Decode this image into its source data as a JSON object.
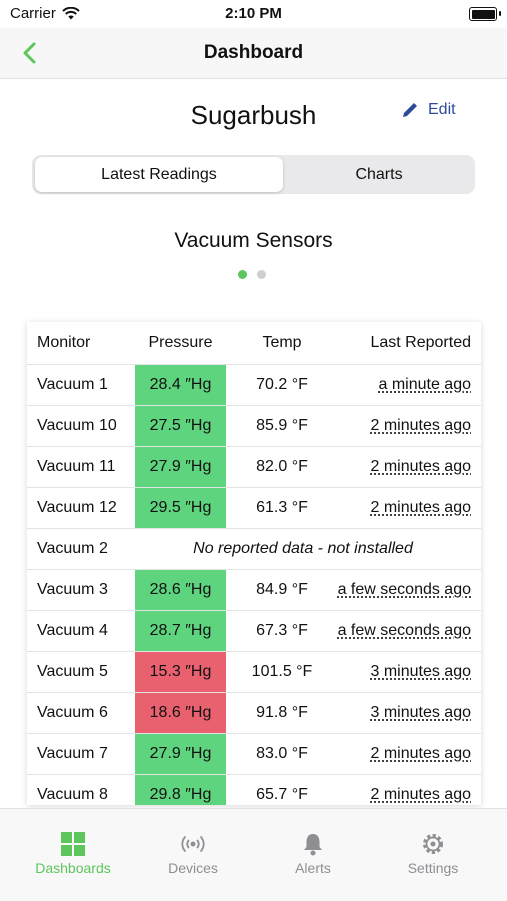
{
  "status_bar": {
    "carrier": "Carrier",
    "time": "2:10 PM"
  },
  "nav": {
    "title": "Dashboard",
    "back_icon": "chevron-left-icon"
  },
  "page": {
    "title": "Sugarbush",
    "edit_label": "Edit"
  },
  "segments": [
    {
      "label": "Latest Readings",
      "active": true
    },
    {
      "label": "Charts",
      "active": false
    }
  ],
  "section": {
    "title": "Vacuum Sensors",
    "page_count": 2,
    "current_page": 1
  },
  "table": {
    "headers": [
      "Monitor",
      "Pressure",
      "Temp",
      "Last Reported"
    ],
    "rows": [
      {
        "monitor": "Vacuum 1",
        "pressure": "28.4 ″Hg",
        "status": "good",
        "temp": "70.2 °F",
        "reported": "a minute ago"
      },
      {
        "monitor": "Vacuum 10",
        "pressure": "27.5 ″Hg",
        "status": "good",
        "temp": "85.9 °F",
        "reported": "2 minutes ago"
      },
      {
        "monitor": "Vacuum 11",
        "pressure": "27.9 ″Hg",
        "status": "good",
        "temp": "82.0 °F",
        "reported": "2 minutes ago"
      },
      {
        "monitor": "Vacuum 12",
        "pressure": "29.5 ″Hg",
        "status": "good",
        "temp": "61.3 °F",
        "reported": "2 minutes ago"
      },
      {
        "monitor": "Vacuum 2",
        "note": "No reported data - not installed"
      },
      {
        "monitor": "Vacuum 3",
        "pressure": "28.6 ″Hg",
        "status": "good",
        "temp": "84.9 °F",
        "reported": "a few seconds ago"
      },
      {
        "monitor": "Vacuum 4",
        "pressure": "28.7 ″Hg",
        "status": "good",
        "temp": "67.3 °F",
        "reported": "a few seconds ago"
      },
      {
        "monitor": "Vacuum 5",
        "pressure": "15.3 ″Hg",
        "status": "bad",
        "temp": "101.5 °F",
        "reported": "3 minutes ago"
      },
      {
        "monitor": "Vacuum 6",
        "pressure": "18.6 ″Hg",
        "status": "bad",
        "temp": "91.8 °F",
        "reported": "3 minutes ago"
      },
      {
        "monitor": "Vacuum 7",
        "pressure": "27.9 ″Hg",
        "status": "good",
        "temp": "83.0 °F",
        "reported": "2 minutes ago"
      },
      {
        "monitor": "Vacuum 8",
        "pressure": "29.8 ″Hg",
        "status": "good",
        "temp": "65.7 °F",
        "reported": "2 minutes ago"
      }
    ]
  },
  "tabs": [
    {
      "label": "Dashboards",
      "icon": "grid-icon",
      "active": true
    },
    {
      "label": "Devices",
      "icon": "broadcast-icon",
      "active": false
    },
    {
      "label": "Alerts",
      "icon": "bell-icon",
      "active": false
    },
    {
      "label": "Settings",
      "icon": "gear-icon",
      "active": false
    }
  ],
  "colors": {
    "accent_green": "#5cc65c",
    "good": "#5fd47f",
    "bad": "#e9616f",
    "link_blue": "#2e4a9a",
    "inactive_gray": "#8e8e93",
    "dot_inactive": "#cfcfcf"
  }
}
